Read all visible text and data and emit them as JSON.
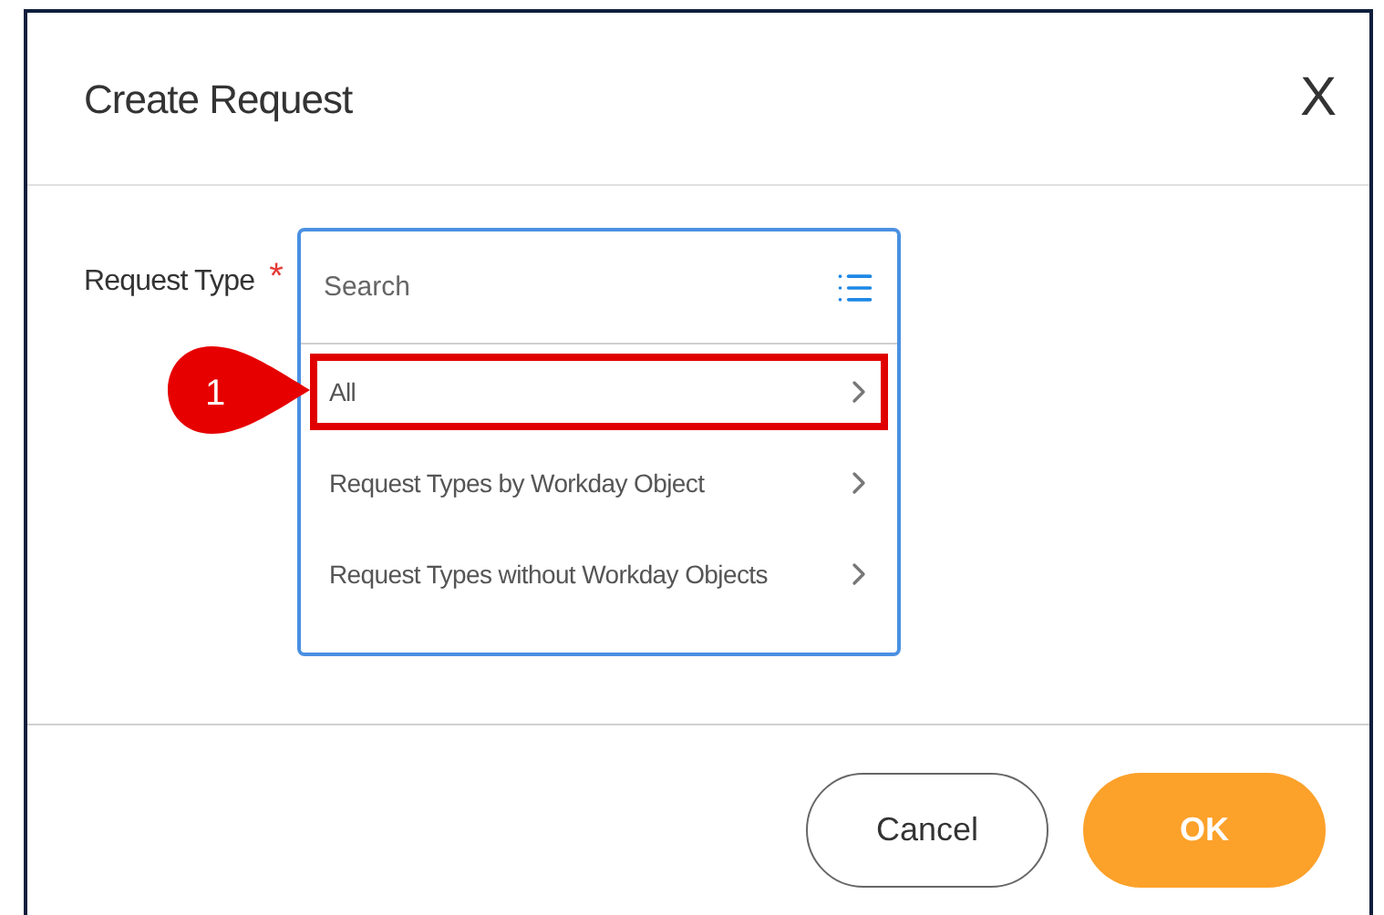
{
  "dialog": {
    "title": "Create Request",
    "close": "X"
  },
  "field": {
    "label": "Request Type",
    "required": true,
    "required_mark": "*",
    "placeholder": "Search"
  },
  "options": [
    {
      "label": "All",
      "highlighted": true,
      "callout": "1"
    },
    {
      "label": "Request Types by Workday Object",
      "highlighted": false
    },
    {
      "label": "Request Types without Workday Objects",
      "highlighted": false
    }
  ],
  "buttons": [
    {
      "label": "Cancel",
      "kind": "secondary"
    },
    {
      "label": "OK",
      "kind": "primary"
    }
  ]
}
